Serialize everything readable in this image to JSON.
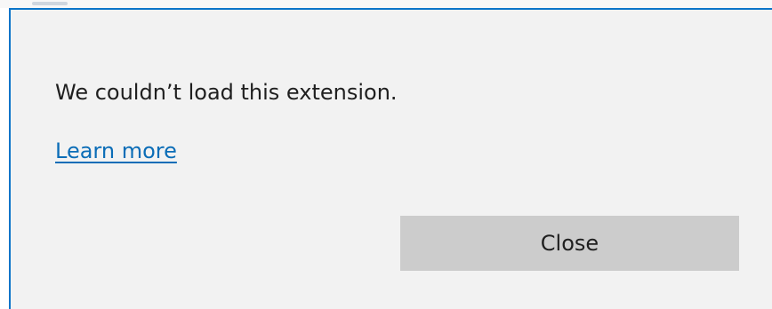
{
  "dialog": {
    "message": "We couldn’t load this extension.",
    "learn_more_label": "Learn more",
    "close_label": "Close"
  },
  "colors": {
    "dialog_background": "#f2f2f2",
    "accent_border": "#0a74c9",
    "link": "#0b6db7",
    "button_background": "#cccccc"
  }
}
